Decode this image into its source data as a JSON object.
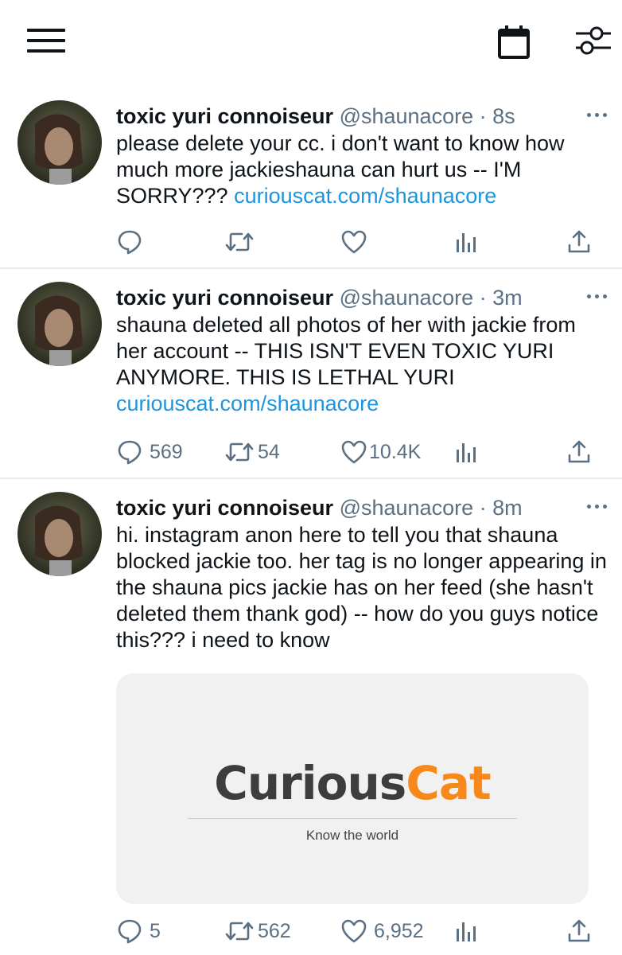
{
  "toolbar": {
    "menu_icon": "hamburger-menu-icon",
    "calendar_icon": "calendar-icon",
    "filter_icon": "sliders-icon"
  },
  "tweets": [
    {
      "name": "toxic yuri connoiseur",
      "handle": "@shaunacore",
      "dot": "·",
      "time": "8s",
      "text": "please delete your cc. i don't want to know how much more jackieshauna can hurt us -- I'M SORRY???",
      "link": "curiouscat.com/shaunacore",
      "reply_count": "",
      "retweet_count": "",
      "like_count": ""
    },
    {
      "name": "toxic yuri connoiseur",
      "handle": "@shaunacore",
      "dot": "·",
      "time": "3m",
      "text": "shauna deleted all photos of her with jackie from her account -- THIS ISN'T EVEN TOXIC YURI ANYMORE. THIS IS LETHAL YURI",
      "link": "curiouscat.com/shaunacore",
      "reply_count": "569",
      "retweet_count": "54",
      "like_count": "10.4K"
    },
    {
      "name": "toxic yuri connoiseur",
      "handle": "@shaunacore",
      "dot": "·",
      "time": "8m",
      "text": "hi. instagram anon here to tell you that shauna blocked jackie too. her tag is no longer appearing in the shauna pics jackie has on her feed (she hasn't deleted them thank god) -- how do you guys notice this??? i need to know",
      "link": "",
      "reply_count": "5",
      "retweet_count": "562",
      "like_count": "6,952",
      "card": {
        "logo_part1": "Curious",
        "logo_part2": "Cat",
        "tagline": "Know the world",
        "colors": {
          "dark": "#3d3d3d",
          "orange": "#f7891b"
        }
      }
    }
  ],
  "colors": {
    "link": "#1b95e0",
    "muted": "#5b7083",
    "text": "#0f1419",
    "divider": "#e6ecf0"
  }
}
